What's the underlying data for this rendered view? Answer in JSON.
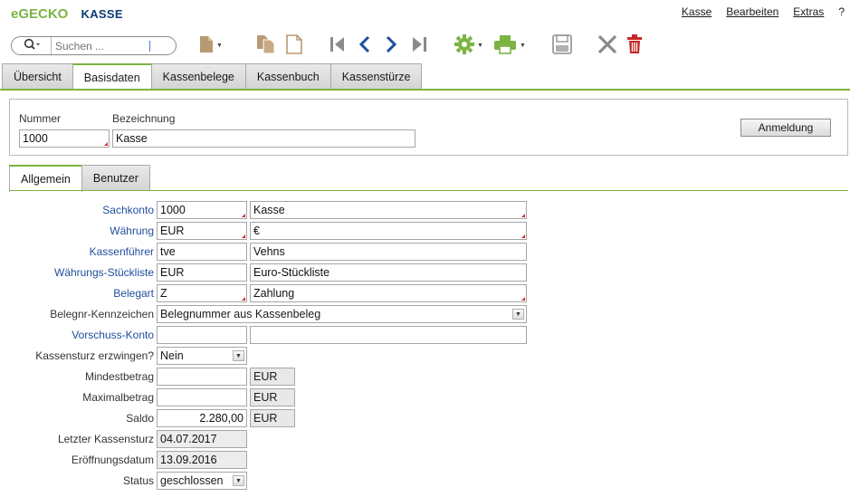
{
  "app": {
    "brand_e": "e",
    "brand_gecko": "GECKO",
    "title": "KASSE"
  },
  "menu": {
    "items": [
      "Kasse",
      "Bearbeiten",
      "Extras",
      "?"
    ]
  },
  "search": {
    "placeholder": "Suchen ..."
  },
  "toolbar": {
    "icons": [
      "new-document-icon",
      "copy-icon",
      "paste-icon",
      "first-record-icon",
      "previous-record-icon",
      "next-record-icon",
      "last-record-icon",
      "settings-gear-icon",
      "print-icon",
      "save-icon",
      "cancel-icon",
      "delete-trash-icon"
    ]
  },
  "tabs": [
    "Übersicht",
    "Basisdaten",
    "Kassenbelege",
    "Kassenbuch",
    "Kassenstürze"
  ],
  "header": {
    "nummer_label": "Nummer",
    "nummer_value": "1000",
    "bezeichnung_label": "Bezeichnung",
    "bezeichnung_value": "Kasse",
    "anmeldung_label": "Anmeldung"
  },
  "subtabs": [
    "Allgemein",
    "Benutzer"
  ],
  "form": {
    "sachkonto": {
      "label": "Sachkonto",
      "code": "1000",
      "text": "Kasse"
    },
    "waehrung": {
      "label": "Währung",
      "code": "EUR",
      "text": "€"
    },
    "kassenfuehrer": {
      "label": "Kassenführer",
      "code": "tve",
      "text": "Vehns"
    },
    "waehrungs_stueckliste": {
      "label": "Währungs-Stückliste",
      "code": "EUR",
      "text": "Euro-Stückliste"
    },
    "belegart": {
      "label": "Belegart",
      "code": "Z",
      "text": "Zahlung"
    },
    "belegnr_kennzeichen": {
      "label": "Belegnr-Kennzeichen",
      "value": "Belegnummer aus Kassenbeleg"
    },
    "vorschuss_konto": {
      "label": "Vorschuss-Konto",
      "code": "",
      "text": ""
    },
    "kassensturz_erzwingen": {
      "label": "Kassensturz erzwingen?",
      "value": "Nein"
    },
    "mindestbetrag": {
      "label": "Mindestbetrag",
      "value": "",
      "unit": "EUR"
    },
    "maximalbetrag": {
      "label": "Maximalbetrag",
      "value": "",
      "unit": "EUR"
    },
    "saldo": {
      "label": "Saldo",
      "value": "2.280,00",
      "unit": "EUR"
    },
    "letzter_kassensturz": {
      "label": "Letzter Kassensturz",
      "value": "04.07.2017"
    },
    "eroeffnungsdatum": {
      "label": "Eröffnungsdatum",
      "value": "13.09.2016"
    },
    "status": {
      "label": "Status",
      "value": "geschlossen"
    }
  },
  "colors": {
    "accent_green": "#7cb342",
    "title_blue": "#0d3a73",
    "link_blue": "#1f4e9c",
    "required_red": "#d32f2f",
    "delete_red": "#c62828"
  }
}
